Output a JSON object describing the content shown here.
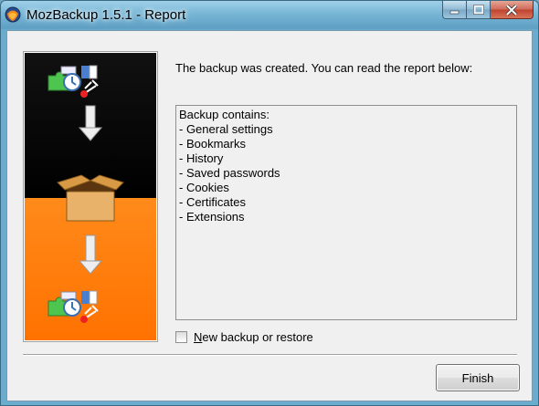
{
  "window": {
    "title": "MozBackup 1.5.1 - Report",
    "icon": "mozbackup-app-icon"
  },
  "caption_buttons": {
    "minimize_icon": "minimize-icon",
    "maximize_icon": "maximize-icon",
    "close_icon": "close-icon"
  },
  "side_image": {
    "icon": "backup-illustration",
    "colors": {
      "top": "#000000",
      "bottom": "#ff7a00"
    }
  },
  "message": "The backup was created. You can read the report below:",
  "report": {
    "lines": [
      "Backup contains:",
      "- General settings",
      "- Bookmarks",
      "- History",
      "- Saved passwords",
      "- Cookies",
      "- Certificates",
      "- Extensions"
    ]
  },
  "new_backup": {
    "hotkey": "N",
    "label_rest": "ew backup or restore",
    "checked": false
  },
  "finish_label": "Finish"
}
